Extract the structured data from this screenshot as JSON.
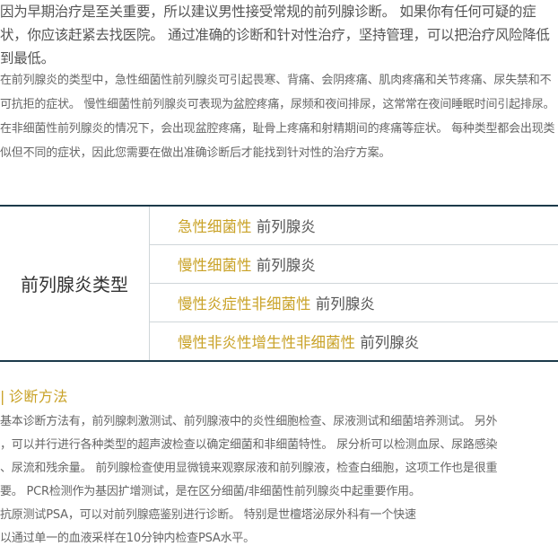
{
  "intro_large": "因为早期治疗是至关重要，所以建议男性接受常规的前列腺诊断。 如果你有任何可疑的症状，你应该赶紧去找医院。 通过准确的诊断和针对性治疗，坚持管理，可以把治疗风险降低到最低。",
  "intro_small": "在前列腺炎的类型中，急性细菌性前列腺炎可引起畏寒、背痛、会阴疼痛、肌肉疼痛和关节疼痛、尿失禁和不可抗拒的症状。 慢性细菌性前列腺炎可表现为盆腔疼痛，尿频和夜间排尿，这常常在夜间睡眠时间引起排尿。 在非细菌性前列腺炎的情况下，会出现盆腔疼痛，耻骨上疼痛和射精期间的疼痛等症状。 每种类型都会出现类似但不同的症状，因此您需要在做出准确诊断后才能找到针对性的治疗方案。",
  "table": {
    "heading": "前列腺炎类型",
    "rows": [
      {
        "highlight": "急性细菌性",
        "rest": " 前列腺炎"
      },
      {
        "highlight": "慢性细菌性",
        "rest": " 前列腺炎"
      },
      {
        "highlight": "慢性炎症性非细菌性",
        "rest": " 前列腺炎"
      },
      {
        "highlight": "慢性非炎性增生性非细菌性",
        "rest": " 前列腺炎"
      }
    ]
  },
  "diagnosis": {
    "bar": "|",
    "title": "诊断方法",
    "lines": [
      "基本诊断方法有，前列腺刺激测试、前列腺液中的炎性细胞检查、尿液测试和细菌培养测试。 另外",
      "，可以并行进行各种类型的超声波检查以确定细菌和非细菌特性。 尿分析可以检测血尿、尿路感染",
      "、尿流和残余量。 前列腺检查使用显微镜来观察尿液和前列腺液，检查白细胞，这项工作也是很重",
      "要。 PCR检测作为基因扩增测试，是在区分细菌/非细菌性前列腺炎中起重要作用。",
      "抗原测试PSA，可以对前列腺癌鉴别进行诊断。 特别是世檀塔泌尿外科有一个快速",
      "以通过单一的血液采样在10分钟内检查PSA水平。"
    ]
  },
  "colors": {
    "accent": "#c9a227",
    "table_border": "#1c3a4a"
  }
}
